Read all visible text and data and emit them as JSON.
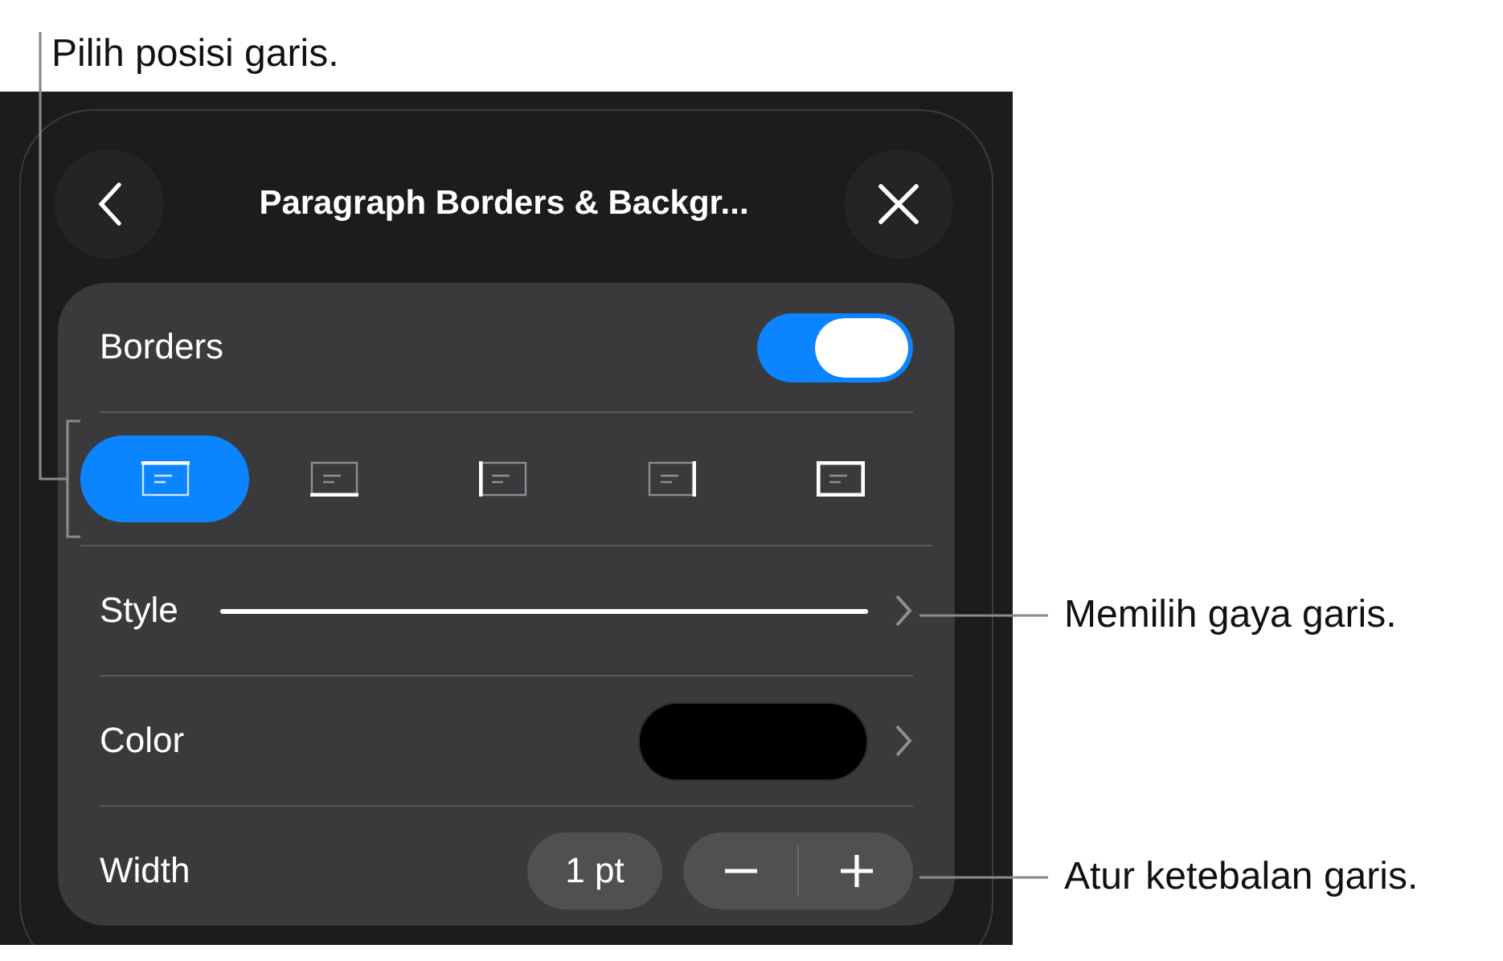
{
  "callouts": [
    {
      "text": "Pilih posisi garis."
    },
    {
      "text": "Memilih gaya garis."
    },
    {
      "text": "Atur ketebalan garis."
    }
  ],
  "panel": {
    "title": "Paragraph Borders & Backgr...",
    "borders": {
      "label": "Borders",
      "on": true
    },
    "positions": [
      {
        "kind": "top",
        "selected": true
      },
      {
        "kind": "bottom",
        "selected": false
      },
      {
        "kind": "left",
        "selected": false
      },
      {
        "kind": "right",
        "selected": false
      },
      {
        "kind": "box",
        "selected": false
      }
    ],
    "style": {
      "label": "Style"
    },
    "color": {
      "label": "Color",
      "color": "#000000"
    },
    "width": {
      "label": "Width",
      "value": "1 pt"
    }
  }
}
